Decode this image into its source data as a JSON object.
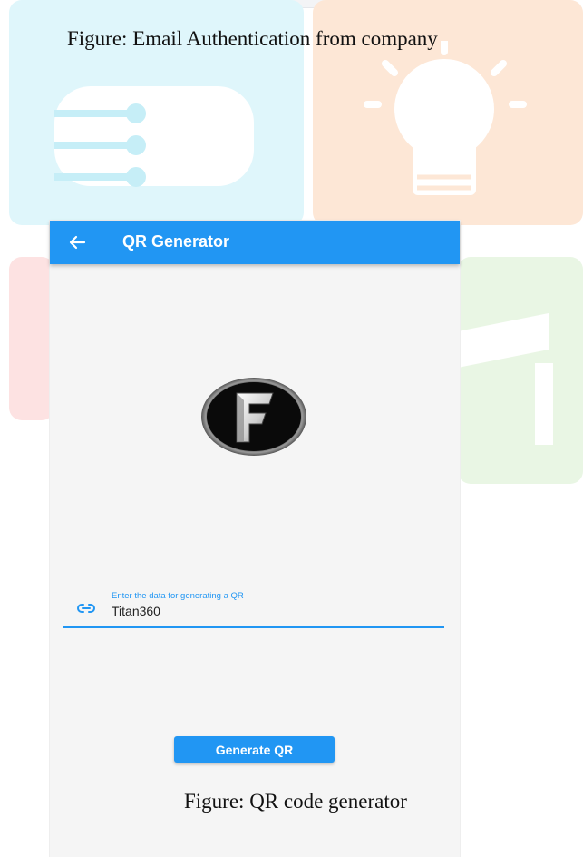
{
  "captions": {
    "top": "Figure: Email Authentication from company",
    "bottom": "Figure: QR code generator"
  },
  "app": {
    "title": "QR Generator",
    "back_icon": "arrow-left-icon",
    "logo_letter": "F"
  },
  "qr_form": {
    "label": "Enter the data for generating a QR",
    "value": "Titan360",
    "field_icon": "link-icon",
    "button_label": "Generate QR"
  },
  "colors": {
    "primary": "#2196f3",
    "background": "#f5f5f5"
  }
}
